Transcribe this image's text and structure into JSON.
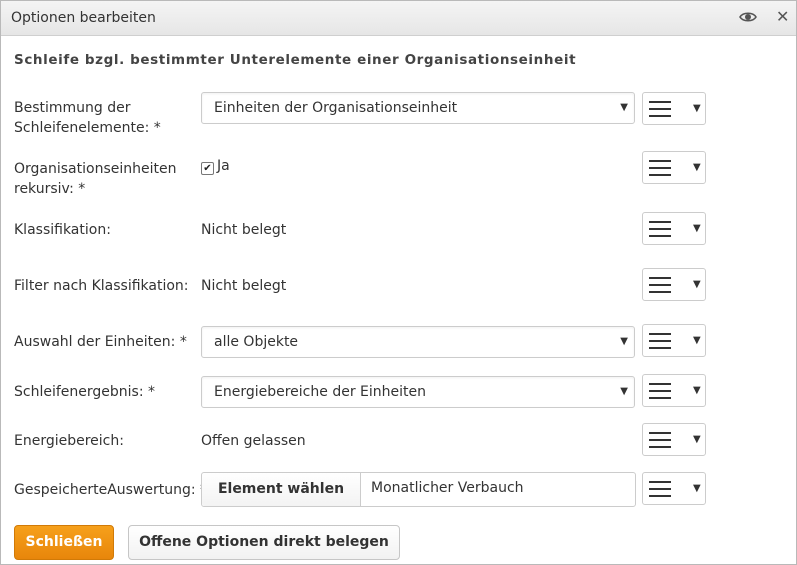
{
  "dialog": {
    "title": "Optionen bearbeiten",
    "heading": "Schleife bzgl. bestimmter Unterelemente einer Organisationseinheit"
  },
  "fields": {
    "bestimmung": {
      "label_line1": "Bestimmung der",
      "label_line2": "Schleifenelemente: *",
      "value": "Einheiten der Organisationseinheit"
    },
    "rekursiv": {
      "label_line1": "Organisationseinheiten",
      "label_line2": "rekursiv: *",
      "checkbox_label": "Ja",
      "checked": true
    },
    "klassifikation": {
      "label": "Klassifikation:",
      "value": "Nicht belegt"
    },
    "filter": {
      "label": "Filter nach Klassifikation:",
      "value": "Nicht belegt"
    },
    "auswahl": {
      "label": "Auswahl der Einheiten: *",
      "value": "alle Objekte"
    },
    "ergebnis": {
      "label": "Schleifenergebnis: *",
      "value": "Energiebereiche der Einheiten"
    },
    "energiebereich": {
      "label": "Energiebereich:",
      "value": "Offen gelassen"
    },
    "auswertung": {
      "label": "GespeicherteAuswertung: *",
      "button_label": "Element wählen",
      "value": "Monatlicher Verbauch"
    }
  },
  "buttons": {
    "close_label": "Schließen",
    "fill_open_label": "Offene Optionen direkt belegen"
  },
  "colors": {
    "primary": "#f39515",
    "border": "#cccccc"
  },
  "icons": {
    "preview": "eye-icon",
    "close": "close-icon",
    "menu": "hamburger-icon",
    "dropdown": "caret-down-icon"
  }
}
